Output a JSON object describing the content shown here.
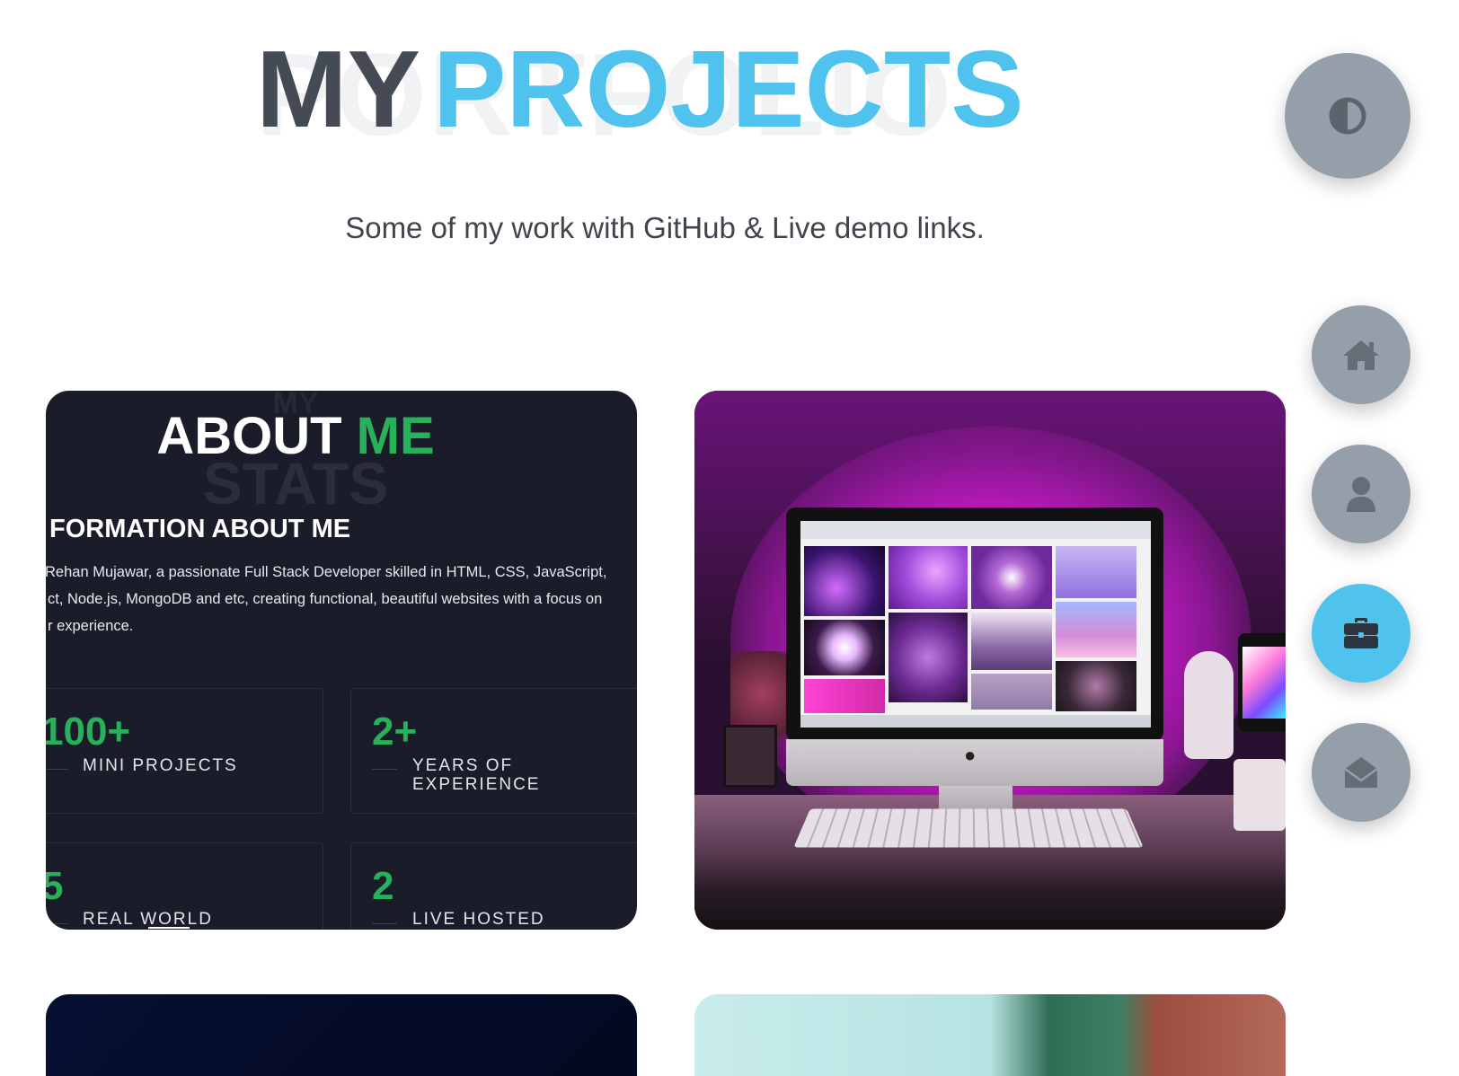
{
  "header": {
    "watermark": "PORTFOLIO",
    "title_part1": "MY",
    "title_part2": "PROJECTS",
    "subtitle": "Some of my work with GitHub & Live demo links."
  },
  "colors": {
    "accent_blue": "#4fc3ee",
    "title_gray": "#454b54",
    "accent_green": "#27b15a",
    "fab_gray": "#959fa9",
    "card_dark": "#1a1d29"
  },
  "nav": {
    "theme_icon": "half-circle-icon",
    "items": [
      {
        "name": "home",
        "icon": "home-icon",
        "active": false
      },
      {
        "name": "about",
        "icon": "user-icon",
        "active": false
      },
      {
        "name": "projects",
        "icon": "briefcase-icon",
        "active": true
      },
      {
        "name": "contact",
        "icon": "envelope-open-icon",
        "active": false
      }
    ]
  },
  "projects": [
    {
      "preview": {
        "bg_my": "MY",
        "bg_stats": "STATS",
        "title_white": "ABOUT",
        "title_green": "ME",
        "heading": "FORMATION ABOUT ME",
        "paragraph": [
          "Rehan Mujawar, a passionate Full Stack Developer skilled in HTML, CSS, JavaScript,",
          "ct, Node.js, MongoDB and etc, creating functional, beautiful websites with a focus on",
          "r experience."
        ],
        "stats": [
          {
            "number": "100+",
            "label": "MINI PROJECTS"
          },
          {
            "number": "2+",
            "label_line1": "YEARS OF",
            "label_line2": "EXPERIENCE"
          },
          {
            "number": "5",
            "label": "REAL WORLD"
          },
          {
            "number": "2",
            "label": "LIVE HOSTED"
          }
        ]
      }
    },
    {
      "preview": "desk-setup-photo"
    },
    {
      "preview": "dark-blue-photo"
    },
    {
      "preview": "building-photo"
    }
  ]
}
